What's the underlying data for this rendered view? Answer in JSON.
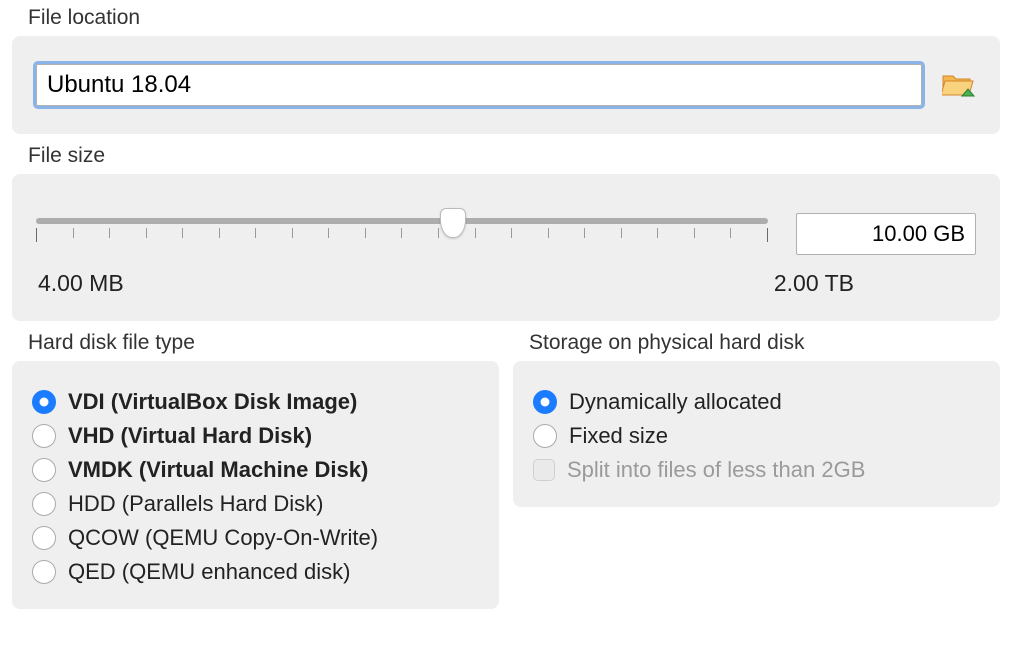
{
  "file_location": {
    "label": "File location",
    "value": "Ubuntu 18.04"
  },
  "file_size": {
    "label": "File size",
    "value_display": "10.00 GB",
    "min_label": "4.00 MB",
    "max_label": "2.00 TB",
    "slider_percent": 57
  },
  "disk_type": {
    "label": "Hard disk file type",
    "options": [
      {
        "label": "VDI (VirtualBox Disk Image)",
        "selected": true,
        "bold": true
      },
      {
        "label": "VHD (Virtual Hard Disk)",
        "selected": false,
        "bold": true
      },
      {
        "label": "VMDK (Virtual Machine Disk)",
        "selected": false,
        "bold": true
      },
      {
        "label": "HDD (Parallels Hard Disk)",
        "selected": false,
        "bold": false
      },
      {
        "label": "QCOW (QEMU Copy-On-Write)",
        "selected": false,
        "bold": false
      },
      {
        "label": "QED (QEMU enhanced disk)",
        "selected": false,
        "bold": false
      }
    ]
  },
  "storage": {
    "label": "Storage on physical hard disk",
    "options": [
      {
        "label": "Dynamically allocated",
        "selected": true
      },
      {
        "label": "Fixed size",
        "selected": false
      }
    ],
    "split": {
      "label": "Split into files of less than 2GB",
      "checked": false,
      "disabled": true
    }
  }
}
